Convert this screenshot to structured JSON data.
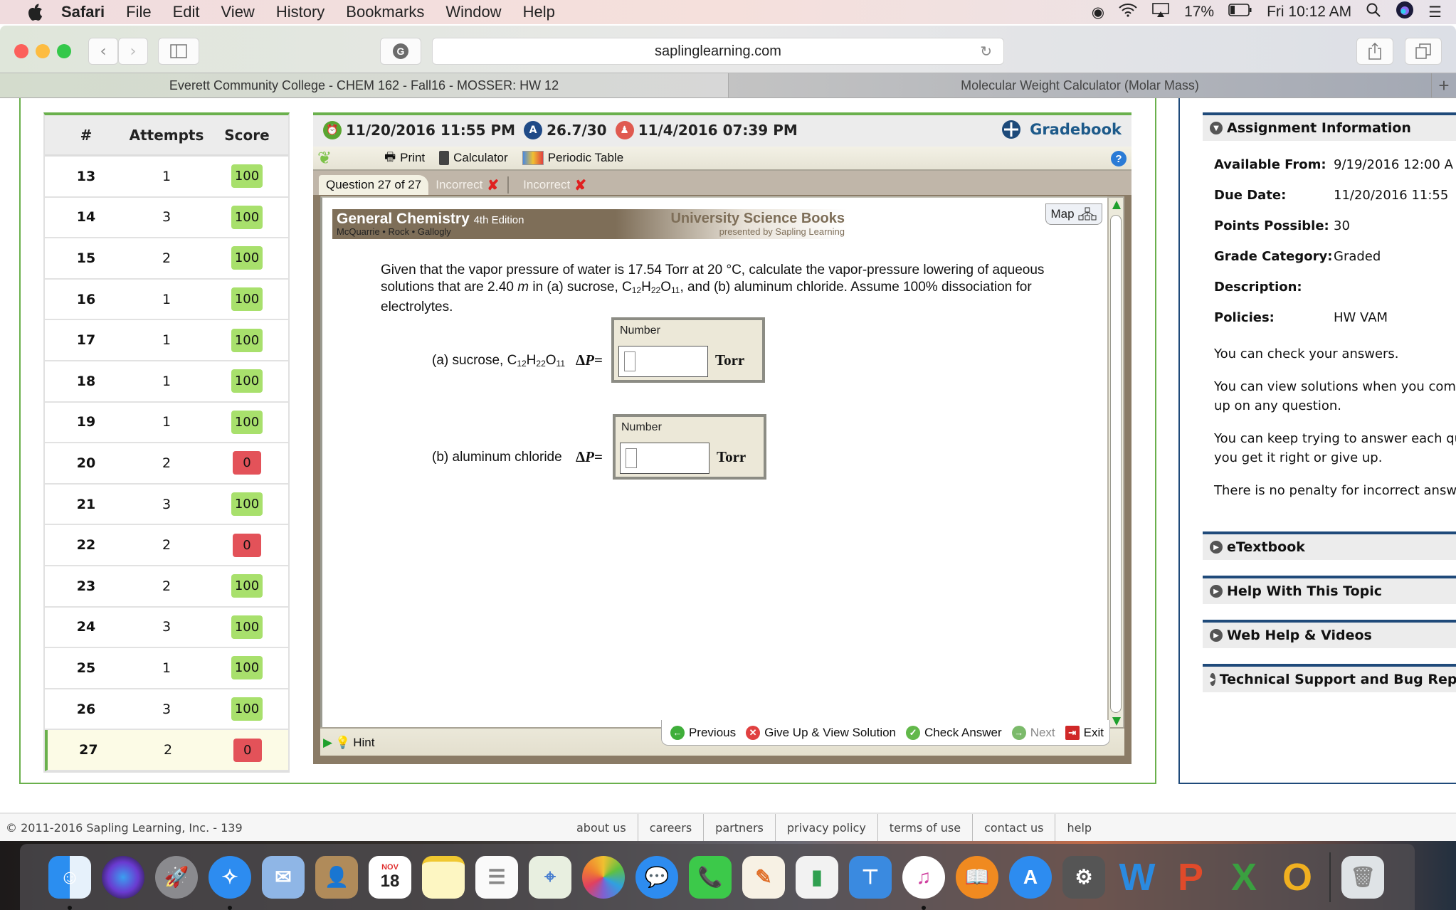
{
  "menubar": {
    "app": "Safari",
    "items": [
      "File",
      "Edit",
      "View",
      "History",
      "Bookmarks",
      "Window",
      "Help"
    ],
    "battery": "17%",
    "clock": "Fri 10:12 AM"
  },
  "browser": {
    "url": "saplinglearning.com",
    "tabs": [
      {
        "label": "Everett Community College - CHEM 162 - Fall16 - MOSSER: HW 12",
        "active": true
      },
      {
        "label": "Molecular Weight Calculator (Molar Mass)",
        "active": false
      }
    ],
    "new_tab": "+"
  },
  "score_table": {
    "headers": [
      "#",
      "Attempts",
      "Score"
    ],
    "rows": [
      {
        "num": "13",
        "attempts": "1",
        "score": "100",
        "status": "pass"
      },
      {
        "num": "14",
        "attempts": "3",
        "score": "100",
        "status": "pass"
      },
      {
        "num": "15",
        "attempts": "2",
        "score": "100",
        "status": "pass"
      },
      {
        "num": "16",
        "attempts": "1",
        "score": "100",
        "status": "pass"
      },
      {
        "num": "17",
        "attempts": "1",
        "score": "100",
        "status": "pass"
      },
      {
        "num": "18",
        "attempts": "1",
        "score": "100",
        "status": "pass"
      },
      {
        "num": "19",
        "attempts": "1",
        "score": "100",
        "status": "pass"
      },
      {
        "num": "20",
        "attempts": "2",
        "score": "0",
        "status": "fail"
      },
      {
        "num": "21",
        "attempts": "3",
        "score": "100",
        "status": "pass"
      },
      {
        "num": "22",
        "attempts": "2",
        "score": "0",
        "status": "fail"
      },
      {
        "num": "23",
        "attempts": "2",
        "score": "100",
        "status": "pass"
      },
      {
        "num": "24",
        "attempts": "3",
        "score": "100",
        "status": "pass"
      },
      {
        "num": "25",
        "attempts": "1",
        "score": "100",
        "status": "pass"
      },
      {
        "num": "26",
        "attempts": "3",
        "score": "100",
        "status": "pass"
      },
      {
        "num": "27",
        "attempts": "2",
        "score": "0",
        "status": "fail",
        "current": true
      }
    ],
    "colors": {
      "pass": "#a8e06c",
      "fail": "#e35259"
    }
  },
  "question_header": {
    "due": "11/20/2016 11:55 PM",
    "grade": "26.7/30",
    "last_visit": "11/4/2016 07:39 PM",
    "gradebook": "Gradebook"
  },
  "applet": {
    "tools": [
      "Print",
      "Calculator",
      "Periodic Table"
    ],
    "question_tab": "Question 27 of 27",
    "attempt_tabs": [
      "Incorrect",
      "Incorrect"
    ],
    "banner": {
      "title": "General Chemistry",
      "edition": "4th Edition",
      "authors": "McQuarrie • Rock • Gallogly",
      "publisher": "University Science Books",
      "presented": "presented by Sapling Learning"
    },
    "map_label": "Map",
    "question_text_1": "Given that the vapor pressure of water is 17.54 Torr at 20 °C, calculate the vapor-pressure lowering of aqueous solutions that are 2.40 ",
    "question_m": "m",
    "question_text_2": " in (a) sucrose, C",
    "question_text_3": ", and (b) aluminum chloride. Assume 100% dissociation for electrolytes.",
    "parts": [
      {
        "label_prefix": "(a) sucrose, C",
        "formula": true,
        "input_label": "Number",
        "value": "",
        "unit": "Torr"
      },
      {
        "label": "(b) aluminum chloride",
        "input_label": "Number",
        "value": "",
        "unit": "Torr"
      }
    ],
    "delta_p": "ΔP=",
    "hint": "Hint",
    "nav": [
      "Previous",
      "Give Up & View Solution",
      "Check Answer",
      "Next",
      "Exit"
    ]
  },
  "sidebar": {
    "assignment_title": "Assignment Information",
    "info": [
      {
        "key": "Available From:",
        "value": "9/19/2016 12:00 A"
      },
      {
        "key": "Due Date:",
        "value": "11/20/2016 11:55"
      },
      {
        "key": "Points Possible:",
        "value": "30"
      },
      {
        "key": "Grade Category:",
        "value": "Graded"
      },
      {
        "key": "Description:",
        "value": ""
      },
      {
        "key": "Policies:",
        "value": "HW VAM"
      }
    ],
    "policies": [
      "You can check your answers.",
      "You can view solutions when you com",
      "up on any question.",
      "You can keep trying to answer each qu",
      "you get it right or give up.",
      "There is no penalty for incorrect answ"
    ],
    "sections": [
      "eTextbook",
      "Help With This Topic",
      "Web Help & Videos",
      "Technical Support and Bug Rep"
    ]
  },
  "footer": {
    "copyright": "© 2011-2016 Sapling Learning, Inc. - 139",
    "links": [
      "about us",
      "careers",
      "partners",
      "privacy policy",
      "terms of use",
      "contact us",
      "help"
    ]
  },
  "dock": {
    "calendar_month": "NOV",
    "calendar_day": "18"
  }
}
